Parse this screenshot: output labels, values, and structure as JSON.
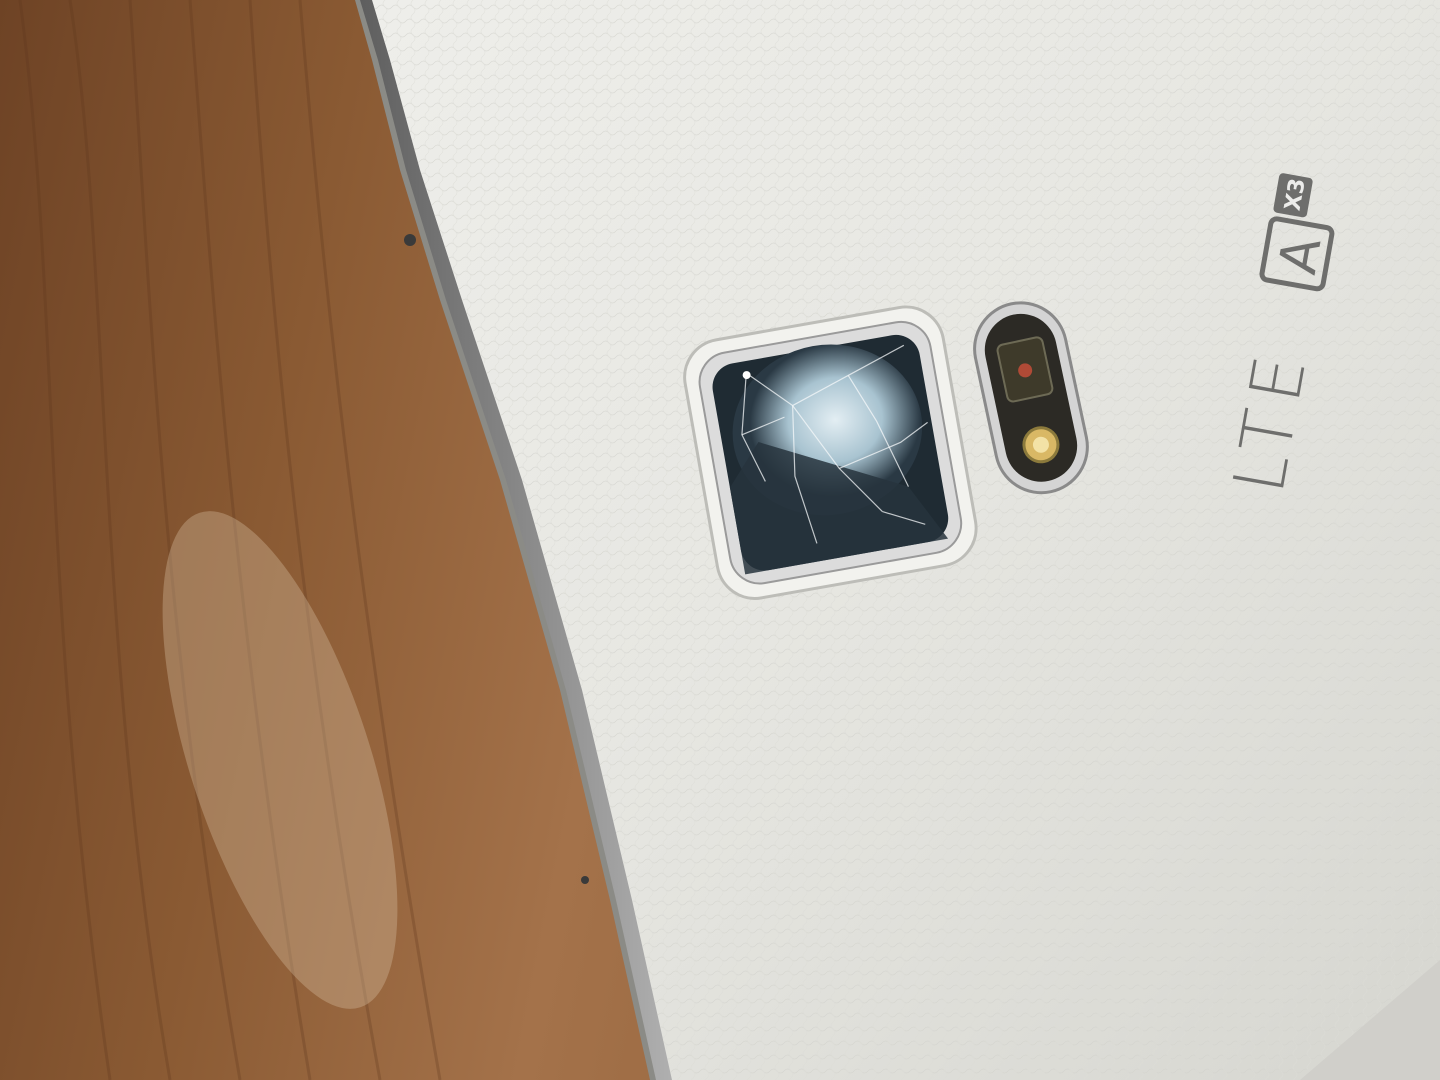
{
  "scene": {
    "subject": "phone-back-with-cracked-camera-lens",
    "colors": {
      "wood_light": "#b98a5a",
      "wood_mid": "#96653a",
      "wood_dark": "#6b4224",
      "phone_body": "#e8e8e3",
      "phone_shadow": "#c9c9c3",
      "chrome": "#d8d8d8",
      "lens_glass": "#1d2830",
      "lens_glow": "#c9dce6",
      "logo_ink": "#6e6e6c"
    },
    "logo": {
      "network_text": "LTE",
      "badge_letter": "A",
      "badge_multiplier": "X3"
    }
  }
}
